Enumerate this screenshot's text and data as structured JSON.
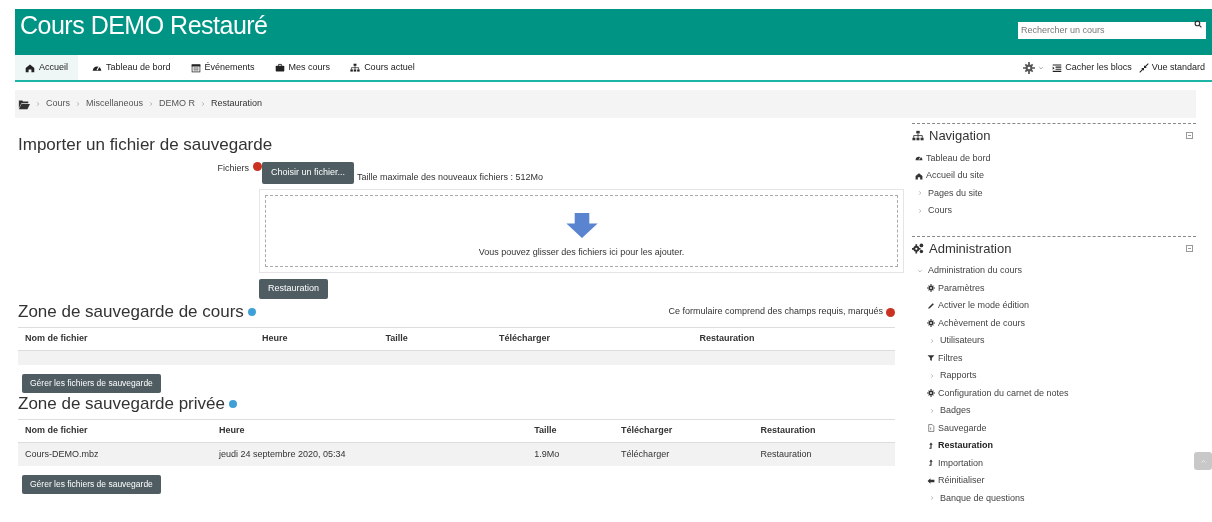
{
  "header": {
    "title": "Cours DEMO Restauré",
    "search": {
      "placeholder": "Rechercher un cours"
    }
  },
  "navbar": {
    "items": [
      {
        "label": "Accueil",
        "selected": true
      },
      {
        "label": "Tableau de bord",
        "selected": false
      },
      {
        "label": "Événements",
        "selected": false
      },
      {
        "label": "Mes cours",
        "selected": false
      },
      {
        "label": "Cours actuel",
        "selected": false
      }
    ],
    "right": [
      "Cacher les blocs",
      "Vue standard"
    ]
  },
  "breadcrumb": [
    "Cours",
    "Miscellaneous",
    "DEMO R",
    "Restauration"
  ],
  "import": {
    "title": "Importer un fichier de sauvegarde",
    "field_label": "Fichiers",
    "choose_button": "Choisir un fichier...",
    "max_size": "Taille maximale des nouveaux fichiers : 512Mo",
    "drop_hint": "Vous pouvez glisser des fichiers ici pour les ajouter.",
    "submit": "Restauration",
    "required_note": "Ce formulaire comprend des champs requis, marqués"
  },
  "zones": [
    {
      "title": "Zone de sauvegarde de cours",
      "columns": [
        "Nom de fichier",
        "Heure",
        "Taille",
        "Télécharger",
        "Restauration"
      ],
      "button": "Gérer les fichiers de sauvegarde"
    },
    {
      "title": "Zone de sauvegarde privée",
      "columns": [
        "Nom de fichier",
        "Heure",
        "Taille",
        "Télécharger",
        "Restauration"
      ],
      "rows": [
        [
          "Cours-DEMO.mbz",
          "jeudi 24 septembre 2020, 05:34",
          "1.9Mo",
          "Télécharger",
          "Restauration"
        ]
      ],
      "button": "Gérer les fichiers de sauvegarde"
    }
  ],
  "sidebar": [
    {
      "title": "Navigation",
      "items": [
        {
          "label": "Tableau de bord",
          "kind": "link",
          "selected": false
        },
        {
          "label": "Accueil du site",
          "kind": "link",
          "selected": false
        },
        {
          "label": "Pages du site",
          "kind": "branch",
          "selected": false
        },
        {
          "label": "Cours",
          "kind": "branch",
          "selected": false
        }
      ]
    },
    {
      "title": "Administration",
      "items": [
        {
          "label": "Administration du cours",
          "kind": "expanded",
          "selected": false,
          "children": [
            {
              "label": "Paramètres",
              "kind": "link",
              "selected": false
            },
            {
              "label": "Activer le mode édition",
              "kind": "link",
              "selected": false
            },
            {
              "label": "Achèvement de cours",
              "kind": "link",
              "selected": false
            },
            {
              "label": "Utilisateurs",
              "kind": "branch",
              "selected": false
            },
            {
              "label": "Filtres",
              "kind": "link",
              "selected": false
            },
            {
              "label": "Rapports",
              "kind": "branch",
              "selected": false
            },
            {
              "label": "Configuration du carnet de notes",
              "kind": "link",
              "selected": false
            },
            {
              "label": "Badges",
              "kind": "branch",
              "selected": false
            },
            {
              "label": "Sauvegarde",
              "kind": "link",
              "selected": false
            },
            {
              "label": "Restauration",
              "kind": "link",
              "selected": true
            },
            {
              "label": "Importation",
              "kind": "link",
              "selected": false
            },
            {
              "label": "Réinitialiser",
              "kind": "link",
              "selected": false
            },
            {
              "label": "Banque de questions",
              "kind": "branch",
              "selected": false
            }
          ]
        }
      ]
    }
  ]
}
